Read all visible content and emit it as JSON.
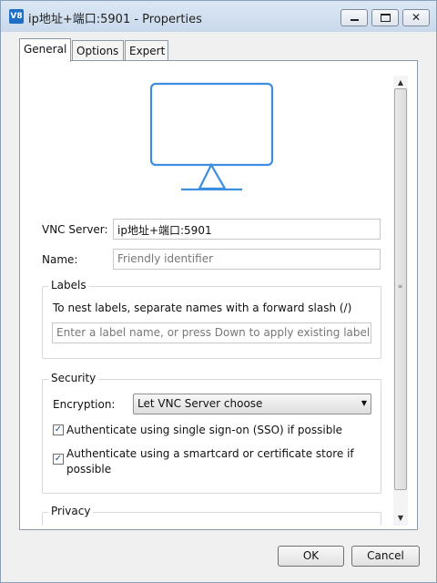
{
  "window": {
    "title": "ip地址+端口:5901 - Properties",
    "icon_text": "V8"
  },
  "window_controls": {
    "minimize": "minimize-icon",
    "maximize": "maximize-icon",
    "close": "close-icon"
  },
  "tabs": [
    {
      "label": "General"
    },
    {
      "label": "Options"
    },
    {
      "label": "Expert"
    }
  ],
  "fields": {
    "vnc_server_label": "VNC Server:",
    "vnc_server_value": "ip地址+端口:5901",
    "name_label": "Name:",
    "name_placeholder": "Friendly identifier"
  },
  "labels_group": {
    "title": "Labels",
    "hint": "To nest labels, separate names with a forward slash (/)",
    "input_placeholder": "Enter a label name, or press Down to apply existing labels"
  },
  "security_group": {
    "title": "Security",
    "encryption_label": "Encryption:",
    "encryption_value": "Let VNC Server choose",
    "sso_label": "Authenticate using single sign-on (SSO) if possible",
    "sso_checked": true,
    "smartcard_label_line1": "Authenticate using a smartcard or certificate store if",
    "smartcard_label_line2": "possible",
    "smartcard_checked": true
  },
  "privacy_group": {
    "title": "Privacy"
  },
  "buttons": {
    "ok": "OK",
    "cancel": "Cancel"
  },
  "colors": {
    "accent": "#3d8ee0",
    "window_border": "#8aa0b8"
  }
}
